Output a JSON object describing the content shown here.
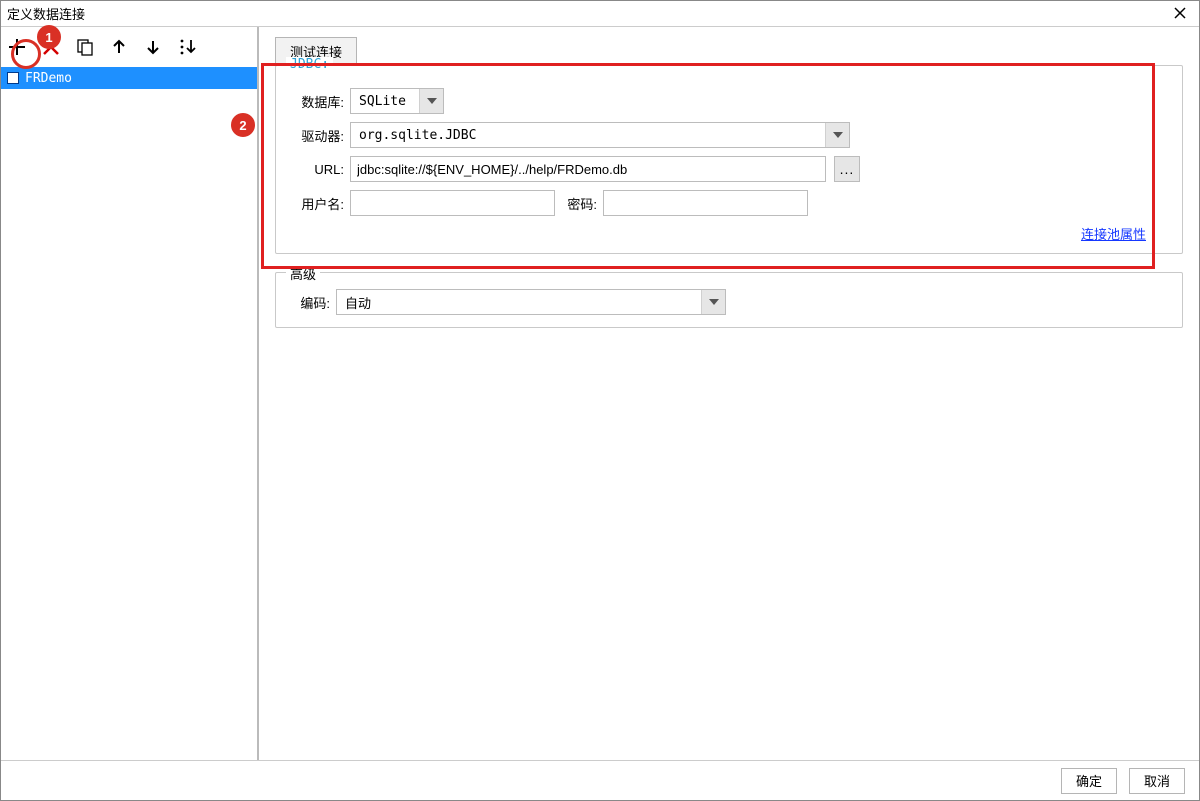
{
  "window": {
    "title": "定义数据连接"
  },
  "callouts": {
    "c1": "1",
    "c2": "2"
  },
  "left": {
    "connection_name": "FRDemo"
  },
  "tabs": {
    "test_connection": "测试连接"
  },
  "jdbc": {
    "legend": "JDBC:",
    "database_label": "数据库:",
    "database_value": "SQLite",
    "driver_label": "驱动器:",
    "driver_value": "org.sqlite.JDBC",
    "url_label": "URL:",
    "url_value": "jdbc:sqlite://${ENV_HOME}/../help/FRDemo.db",
    "url_browse": "...",
    "user_label": "用户名:",
    "user_value": "",
    "password_label": "密码:",
    "password_value": "",
    "pool_link": "连接池属性"
  },
  "advanced": {
    "legend": "高级",
    "encoding_label": "编码:",
    "encoding_value": "自动"
  },
  "footer": {
    "ok": "确定",
    "cancel": "取消"
  }
}
